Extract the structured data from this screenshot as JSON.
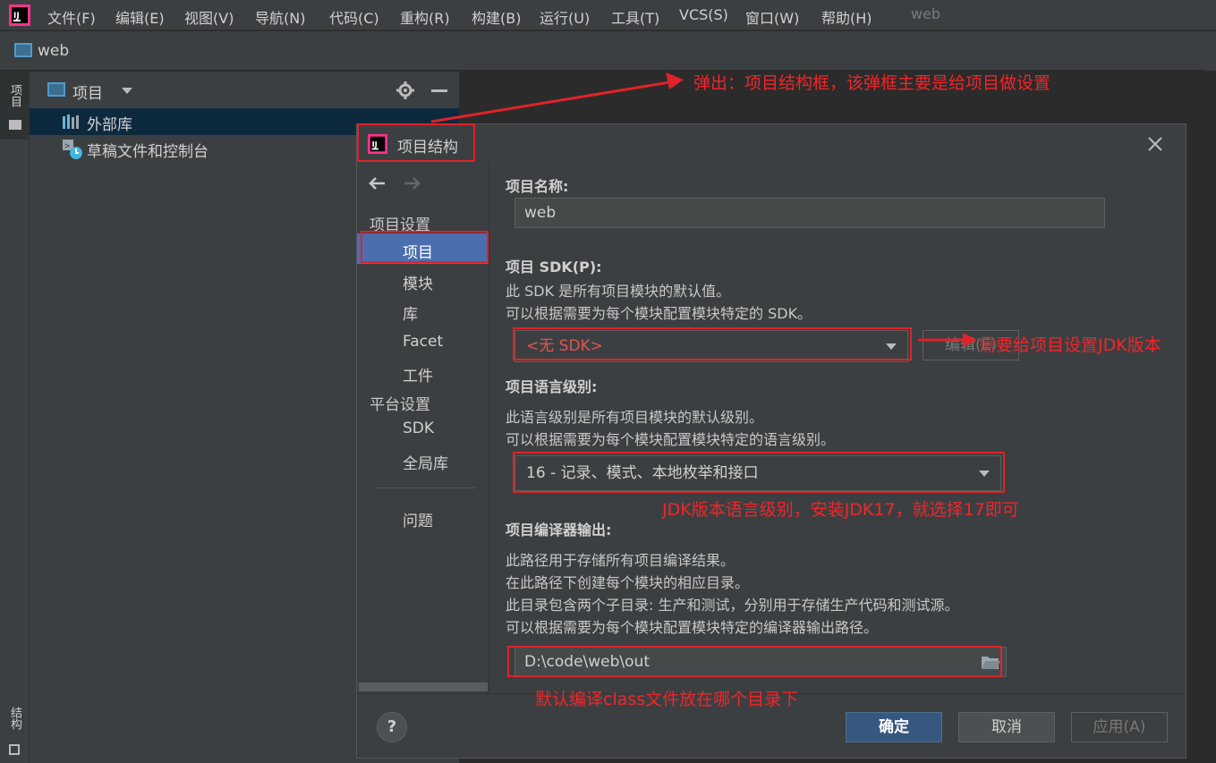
{
  "menubar": {
    "items": [
      "文件(F)",
      "编辑(E)",
      "视图(V)",
      "导航(N)",
      "代码(C)",
      "重构(R)",
      "构建(B)",
      "运行(U)",
      "工具(T)",
      "VCS(S)",
      "窗口(W)",
      "帮助(H)"
    ],
    "title": "web"
  },
  "navbar": {
    "title": "web"
  },
  "left_strip": {
    "project_tab": "项目",
    "structure_tab": "结构"
  },
  "project_panel": {
    "header_label": "项目",
    "tree": [
      "外部库",
      "草稿文件和控制台"
    ]
  },
  "dialog": {
    "title": "项目结构",
    "sidebar": {
      "group_project_settings": "项目设置",
      "items_project": [
        "项目",
        "模块",
        "库",
        "Facet",
        "工件"
      ],
      "group_platform_settings": "平台设置",
      "items_platform": [
        "SDK",
        "全局库"
      ],
      "problems": "问题"
    },
    "content": {
      "name_label": "项目名称:",
      "name_value": "web",
      "sdk_label": "项目 SDK(P):",
      "sdk_desc1": "此 SDK 是所有项目模块的默认值。",
      "sdk_desc2": "可以根据需要为每个模块配置模块特定的 SDK。",
      "sdk_value": "<无 SDK>",
      "sdk_edit_button": "编辑(E)",
      "lang_label": "项目语言级别:",
      "lang_desc1": "此语言级别是所有项目模块的默认级别。",
      "lang_desc2": "可以根据需要为每个模块配置模块特定的语言级别。",
      "lang_value": "16 - 记录、模式、本地枚举和接口",
      "out_label": "项目编译器输出:",
      "out_desc1": "此路径用于存储所有项目编译结果。",
      "out_desc2": "在此路径下创建每个模块的相应目录。",
      "out_desc3": "此目录包含两个子目录: 生产和测试，分别用于存储生产代码和测试源。",
      "out_desc4": "可以根据需要为每个模块配置模块特定的编译器输出路径。",
      "out_value": "D:\\code\\web\\out"
    },
    "buttons": {
      "help": "?",
      "ok": "确定",
      "cancel": "取消",
      "apply": "应用(A)"
    }
  },
  "annotations": {
    "popup": "弹出：项目结构框，该弹框主要是给项目做设置",
    "sdk": "需要给项目设置JDK版本",
    "lang": "JDK版本语言级别，安装JDK17，就选择17即可",
    "output": "默认编译class文件放在哪个目录下"
  },
  "colors": {
    "annotation_red": "#e0222a",
    "selection_blue": "#4b6eaf",
    "primary_button": "#365880"
  }
}
